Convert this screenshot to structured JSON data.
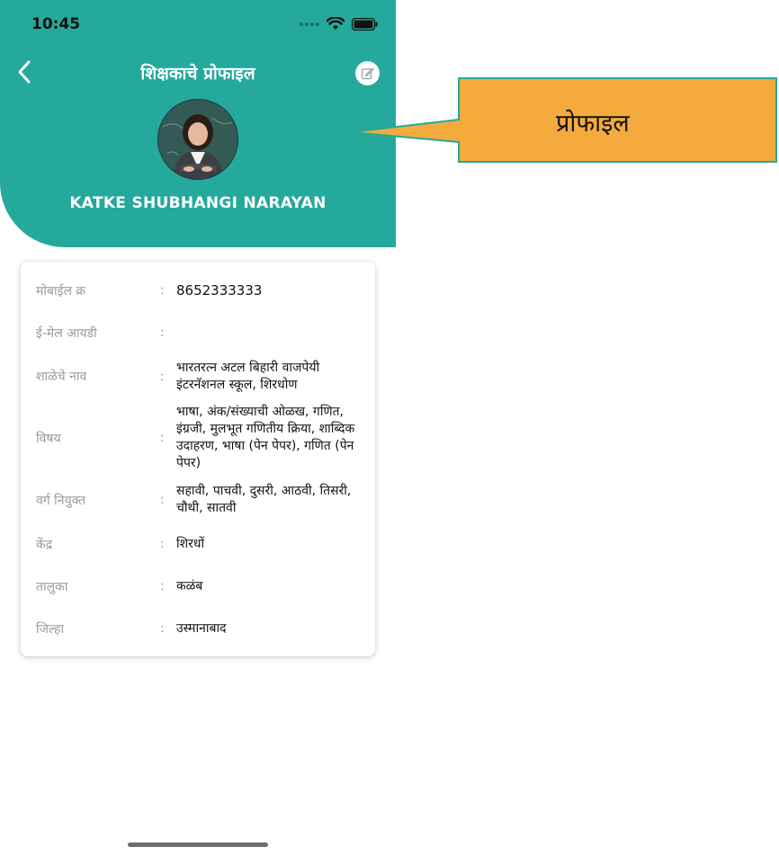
{
  "status": {
    "time": "10:45"
  },
  "header": {
    "title": "शिक्षकाचे प्रोफाइल",
    "name": "KATKE SHUBHANGI NARAYAN"
  },
  "icons": {
    "back": "chevron-left-icon",
    "edit": "edit-icon",
    "wifi": "wifi-icon",
    "battery": "battery-icon"
  },
  "colors": {
    "header_bg": "#24a99c",
    "callout_bg": "#f4aa3c",
    "callout_border": "#24a99c"
  },
  "separator": ":",
  "details": [
    {
      "label": "मोबाईल क्र",
      "value": "8652333333"
    },
    {
      "label": "ई-मेल आयडी",
      "value": ""
    },
    {
      "label": "शाळेचे नाव",
      "value": "भारतरत्न अटल बिहारी वाजपेयी इंटरनॅशनल स्कूल, शिरधोण"
    },
    {
      "label": "विषय",
      "value": "भाषा, अंक/संख्याची ओळख, गणित, इंग्रजी, मुलभूत गणितीय क्रिया, शाब्दिक उदाहरण, भाषा (पेन पेपर), गणित (पेन पेपर)"
    },
    {
      "label": "वर्ग नियुक्त",
      "value": "सहावी, पाचवी, दुसरी, आठवी, तिसरी, चौथी, सातवी"
    },
    {
      "label": "केंद्र",
      "value": "शिरधों"
    },
    {
      "label": "तालुका",
      "value": "कळंब"
    },
    {
      "label": "जिल्हा",
      "value": "उस्मानाबाद"
    }
  ],
  "annotation": {
    "text": "प्रोफाइल"
  }
}
